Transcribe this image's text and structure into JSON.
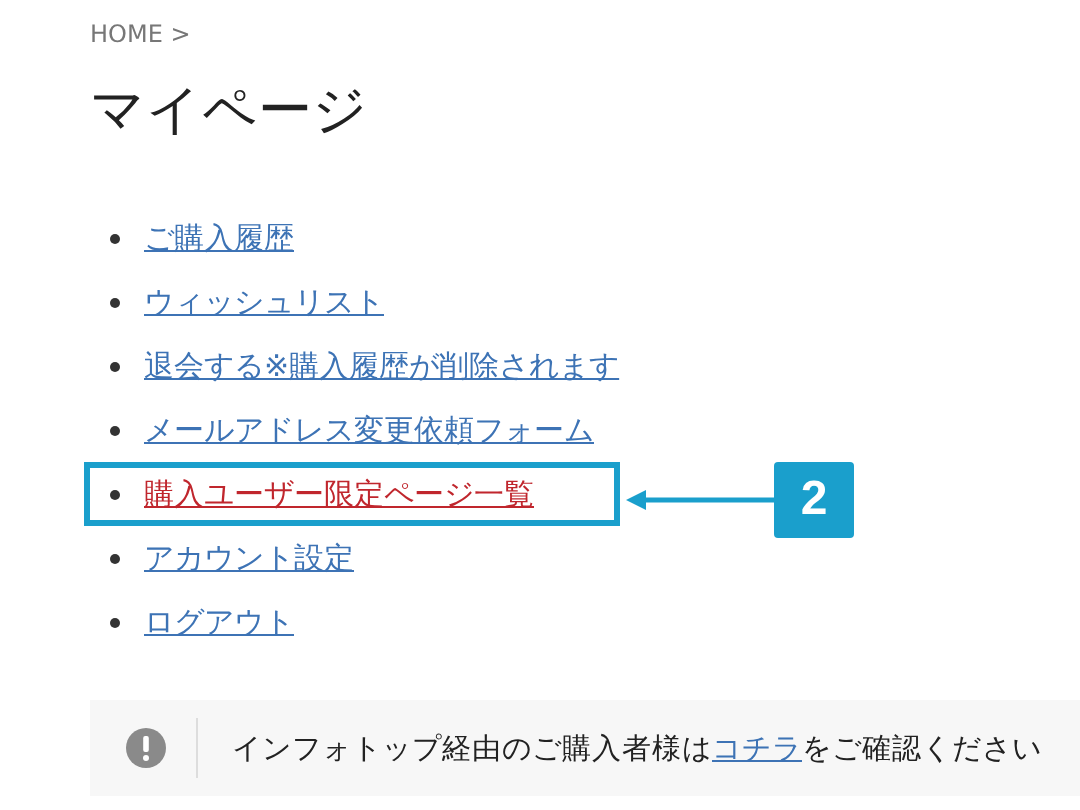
{
  "breadcrumb": "HOME >",
  "title": "マイページ",
  "links": [
    {
      "label": "ご購入履歴",
      "highlighted": false
    },
    {
      "label": "ウィッシュリスト",
      "highlighted": false
    },
    {
      "label": "退会する※購入履歴が削除されます",
      "highlighted": false
    },
    {
      "label": "メールアドレス変更依頼フォーム",
      "highlighted": false
    },
    {
      "label": "購入ユーザー限定ページ一覧",
      "highlighted": true
    },
    {
      "label": "アカウント設定",
      "highlighted": false
    },
    {
      "label": "ログアウト",
      "highlighted": false
    }
  ],
  "callout": "2",
  "notice": {
    "before": "インフォトップ経由のご購入者様は",
    "link": "コチラ",
    "after": "をご確認ください"
  }
}
